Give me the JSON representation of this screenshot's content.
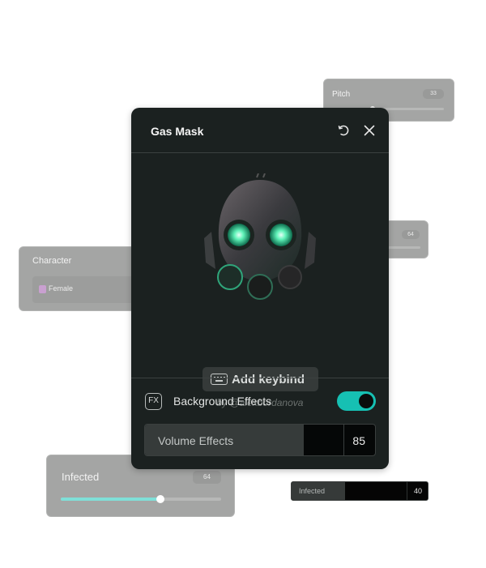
{
  "background_cards": {
    "pitch": {
      "label": "Pitch",
      "value": "33",
      "slider_fraction": 0.35
    },
    "unnamed": {
      "value": "64"
    },
    "character": {
      "label": "Character",
      "selected": "Female"
    },
    "infected_slider": {
      "label": "Infected",
      "value": "64",
      "slider_fraction": 0.62,
      "fill_color": "#7fe0d8"
    },
    "infected_bar": {
      "label": "Infected",
      "value": "40"
    }
  },
  "dialog": {
    "title": "Gas Mask",
    "reset_icon": "reset-icon",
    "close_icon": "close-icon",
    "image_alt": "Gas mask with glowing green eyes",
    "keybind_button": {
      "icon": "keyboard-icon",
      "label": "Add keybind"
    },
    "author": "by @alexbordanova",
    "background_effects": {
      "icon_text": "FX",
      "label": "Background Effects",
      "enabled": true,
      "accent": "#16c0b3"
    },
    "volume_effects": {
      "label": "Volume Effects",
      "value": "85",
      "fraction": 0.69
    }
  }
}
